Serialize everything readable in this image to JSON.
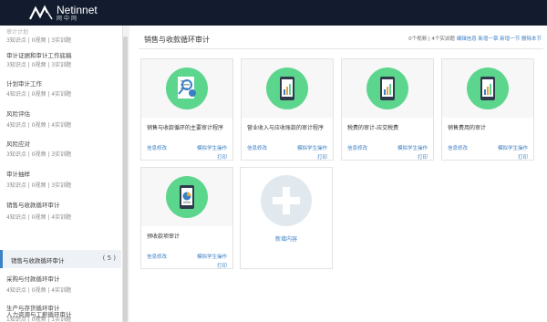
{
  "header": {
    "brand": "Netinnet",
    "brand_cn": "网中网"
  },
  "sidebar": {
    "items": [
      {
        "label": "审计计划",
        "sub": "3知识点 | 0视频 | 3实训题"
      },
      {
        "label": "审计证据和审计工作底稿",
        "sub": "3知识点 | 0视频 | 3实训题"
      },
      {
        "label": "计划审计工作",
        "sub": "4知识点 | 0视频 | 4实训题"
      },
      {
        "label": "风险评估",
        "sub": "4知识点 | 0视频 | 4实训题"
      },
      {
        "label": "风险应对",
        "sub": "3知识点 | 0视频 | 3实训题"
      },
      {
        "label": "审计抽样",
        "sub": "3知识点 | 0视频 | 3实训题"
      },
      {
        "label": "销售与收款循环审计",
        "sub": "4知识点 | 0视频 | 4实训题"
      },
      {
        "label": "采购与付款循环审计",
        "sub": "4知识点 | 0视频 | 4实训题"
      },
      {
        "label": "生产与存货循环审计",
        "sub": "1知识点 | 0视频 | 1实训题"
      },
      {
        "label": "人力资源与工薪循环审计",
        "sub": ""
      }
    ],
    "active": {
      "label": "销售与收款循环审计",
      "count": "( 5 )"
    }
  },
  "main": {
    "title": "销售与收款循环审计",
    "info": {
      "text": "0个视频 | 4个实训题",
      "links": [
        "编辑信息",
        "新增一章",
        "新增一节",
        "删除本节"
      ]
    },
    "cards": [
      {
        "title": "销售与收款循环的主要审计程序",
        "edit": "信息修改",
        "simulate": "模拟学生操作",
        "print": "打印"
      },
      {
        "title": "营业收入与应收账款的审计程序",
        "edit": "信息修改",
        "simulate": "模拟学生操作",
        "print": "打印"
      },
      {
        "title": "税费的审计-应交税费",
        "edit": "信息修改",
        "simulate": "模拟学生操作",
        "print": "打印"
      },
      {
        "title": "销售费用的审计",
        "edit": "信息修改",
        "simulate": "模拟学生操作",
        "print": "打印"
      },
      {
        "title": "预收款项审计",
        "edit": "信息修改",
        "simulate": "模拟学生操作",
        "print": "打印"
      }
    ],
    "add_card": {
      "label": "新增内容"
    }
  },
  "colors": {
    "topbar": "#131c2e",
    "icon_green": "#5dd68d",
    "link_blue": "#3a7fc4"
  }
}
